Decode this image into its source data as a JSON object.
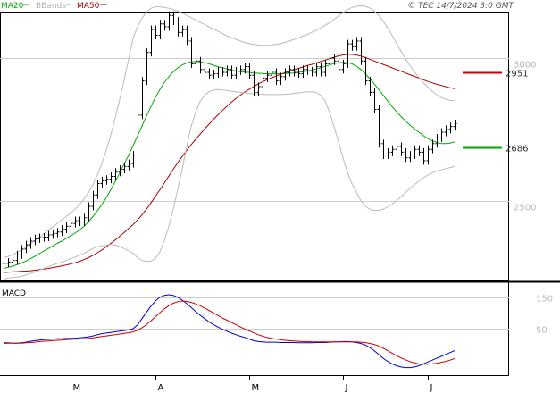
{
  "header": {
    "legend": [
      {
        "label": "MA20",
        "color": "#00aa00"
      },
      {
        "label": "BBands",
        "color": "#b0b0b0"
      },
      {
        "label": "MA50",
        "color": "#aa0000"
      }
    ],
    "source": "© TEC 14/7/2024 3:0 GMT"
  },
  "markers": {
    "resistance": {
      "value": 2951,
      "label": "2951",
      "color": "#cc0000"
    },
    "support": {
      "value": 2686,
      "label": "2686",
      "color": "#00aa00"
    }
  },
  "chart_data": [
    {
      "type": "line",
      "title": "",
      "series_kind": "ohlc-bars",
      "price_axis": {
        "ticks": [
          3000,
          2500
        ],
        "ylim": [
          2220,
          3160
        ]
      },
      "month_labels": [
        {
          "label": "M",
          "index": 15
        },
        {
          "label": "A",
          "index": 34
        },
        {
          "label": "M",
          "index": 55
        },
        {
          "label": "J",
          "index": 76
        },
        {
          "label": "J",
          "index": 95
        }
      ],
      "close": [
        2280,
        2284,
        2290,
        2310,
        2330,
        2345,
        2358,
        2366,
        2370,
        2372,
        2380,
        2385,
        2390,
        2400,
        2410,
        2420,
        2430,
        2425,
        2440,
        2480,
        2520,
        2560,
        2570,
        2575,
        2585,
        2600,
        2610,
        2620,
        2630,
        2660,
        2800,
        2920,
        3020,
        3100,
        3080,
        3120,
        3110,
        3150,
        3130,
        3090,
        3100,
        3060,
        2980,
        2990,
        2960,
        2950,
        2940,
        2945,
        2955,
        2950,
        2960,
        2940,
        2955,
        2960,
        2970,
        2940,
        2880,
        2900,
        2930,
        2940,
        2950,
        2920,
        2935,
        2950,
        2960,
        2950,
        2945,
        2960,
        2955,
        2950,
        2970,
        2950,
        2980,
        3000,
        2990,
        2960,
        2980,
        3050,
        3040,
        3060,
        2990,
        2920,
        2880,
        2820,
        2700,
        2660,
        2670,
        2680,
        2690,
        2670,
        2650,
        2660,
        2680,
        2670,
        2640,
        2680,
        2700,
        2720,
        2740,
        2750,
        2760,
        2770
      ],
      "series": [
        {
          "name": "MA20",
          "values": [
            2262,
            2266,
            2270,
            2275,
            2281,
            2288,
            2296,
            2305,
            2314,
            2323,
            2332,
            2341,
            2350,
            2358,
            2367,
            2376,
            2386,
            2397,
            2410,
            2426,
            2444,
            2464,
            2486,
            2510,
            2538,
            2567,
            2597,
            2628,
            2660,
            2693,
            2727,
            2762,
            2797,
            2830,
            2862,
            2890,
            2914,
            2935,
            2952,
            2966,
            2976,
            2983,
            2987,
            2988,
            2987,
            2984,
            2980,
            2975,
            2970,
            2966,
            2962,
            2958,
            2955,
            2953,
            2951,
            2950,
            2948,
            2947,
            2946,
            2945,
            2945,
            2945,
            2945,
            2946,
            2947,
            2948,
            2950,
            2952,
            2955,
            2958,
            2962,
            2966,
            2971,
            2976,
            2981,
            2984,
            2985,
            2984,
            2980,
            2972,
            2960,
            2945,
            2928,
            2910,
            2890,
            2870,
            2850,
            2830,
            2812,
            2795,
            2780,
            2765,
            2752,
            2740,
            2728,
            2718,
            2710,
            2704,
            2700,
            2700,
            2702,
            2706
          ]
        },
        {
          "name": "MA50",
          "values": [
            2248,
            2249,
            2250,
            2251,
            2252,
            2253,
            2254,
            2256,
            2258,
            2260,
            2262,
            2265,
            2268,
            2271,
            2274,
            2278,
            2282,
            2287,
            2293,
            2300,
            2308,
            2317,
            2327,
            2338,
            2350,
            2362,
            2375,
            2388,
            2402,
            2416,
            2432,
            2450,
            2470,
            2492,
            2515,
            2538,
            2562,
            2586,
            2610,
            2633,
            2655,
            2676,
            2696,
            2715,
            2733,
            2751,
            2768,
            2785,
            2801,
            2816,
            2831,
            2845,
            2858,
            2870,
            2881,
            2891,
            2900,
            2909,
            2917,
            2924,
            2931,
            2937,
            2943,
            2949,
            2954,
            2959,
            2964,
            2969,
            2974,
            2978,
            2983,
            2988,
            2993,
            2998,
            3003,
            3008,
            3011,
            3013,
            3013,
            3011,
            3007,
            3002,
            2996,
            2990,
            2984,
            2978,
            2972,
            2966,
            2960,
            2954,
            2948,
            2942,
            2936,
            2930,
            2924,
            2918,
            2913,
            2908,
            2904,
            2900,
            2896,
            2893
          ]
        },
        {
          "name": "BBands upper",
          "values": [
            2300,
            2304,
            2310,
            2318,
            2327,
            2337,
            2348,
            2360,
            2372,
            2384,
            2396,
            2408,
            2420,
            2432,
            2444,
            2456,
            2470,
            2486,
            2505,
            2528,
            2556,
            2590,
            2630,
            2676,
            2730,
            2790,
            2855,
            2924,
            2996,
            3070,
            3110,
            3140,
            3162,
            3175,
            3180,
            3180,
            3178,
            3175,
            3170,
            3165,
            3158,
            3150,
            3142,
            3134,
            3126,
            3118,
            3110,
            3102,
            3094,
            3086,
            3078,
            3072,
            3066,
            3060,
            3055,
            3051,
            3048,
            3046,
            3045,
            3045,
            3046,
            3048,
            3051,
            3055,
            3060,
            3065,
            3071,
            3077,
            3083,
            3090,
            3098,
            3106,
            3115,
            3125,
            3136,
            3148,
            3160,
            3170,
            3178,
            3182,
            3184,
            3182,
            3176,
            3166,
            3150,
            3130,
            3106,
            3080,
            3052,
            3024,
            2998,
            2974,
            2952,
            2932,
            2914,
            2898,
            2884,
            2872,
            2862,
            2856,
            2852,
            2850
          ]
        },
        {
          "name": "BBands lower",
          "values": [
            2224,
            2228,
            2230,
            2232,
            2235,
            2239,
            2244,
            2250,
            2256,
            2262,
            2268,
            2274,
            2280,
            2284,
            2290,
            2296,
            2302,
            2308,
            2315,
            2324,
            2332,
            2338,
            2342,
            2344,
            2346,
            2344,
            2339,
            2332,
            2324,
            2316,
            2300,
            2290,
            2286,
            2288,
            2296,
            2320,
            2360,
            2410,
            2470,
            2540,
            2610,
            2690,
            2760,
            2810,
            2848,
            2870,
            2882,
            2888,
            2890,
            2888,
            2886,
            2884,
            2882,
            2880,
            2878,
            2876,
            2875,
            2874,
            2873,
            2872,
            2872,
            2872,
            2872,
            2873,
            2874,
            2876,
            2878,
            2880,
            2882,
            2882,
            2880,
            2870,
            2850,
            2810,
            2760,
            2706,
            2650,
            2600,
            2560,
            2530,
            2500,
            2480,
            2470,
            2466,
            2466,
            2470,
            2478,
            2488,
            2500,
            2514,
            2528,
            2542,
            2556,
            2568,
            2580,
            2590,
            2598,
            2604,
            2608,
            2612,
            2616,
            2620
          ]
        }
      ]
    },
    {
      "type": "line",
      "title": "MACD",
      "ylim": [
        -95,
        195
      ],
      "axis_ticks": [
        150,
        50
      ],
      "series": [
        {
          "name": "MACD",
          "values": [
            5,
            5,
            4,
            4,
            5,
            7,
            10,
            12,
            14,
            15,
            16,
            17,
            18,
            18,
            19,
            19,
            20,
            21,
            22,
            24,
            27,
            31,
            34,
            36,
            38,
            40,
            42,
            44,
            46,
            50,
            62,
            82,
            102,
            122,
            138,
            150,
            156,
            158,
            156,
            150,
            141,
            130,
            118,
            105,
            93,
            82,
            72,
            63,
            55,
            48,
            42,
            36,
            31,
            26,
            22,
            17,
            12,
            9,
            8,
            7,
            7,
            7,
            6,
            6,
            6,
            6,
            5,
            5,
            5,
            5,
            6,
            6,
            6,
            7,
            8,
            8,
            9,
            9,
            8,
            6,
            3,
            -2,
            -10,
            -20,
            -32,
            -44,
            -54,
            -62,
            -68,
            -72,
            -74,
            -74,
            -72,
            -68,
            -62,
            -56,
            -50,
            -44,
            -38,
            -32,
            -26,
            -20
          ]
        },
        {
          "name": "Signal",
          "values": [
            3,
            4,
            4,
            4,
            4,
            5,
            6,
            7,
            9,
            10,
            11,
            12,
            13,
            14,
            15,
            16,
            17,
            17,
            18,
            19,
            21,
            23,
            25,
            27,
            29,
            31,
            33,
            35,
            37,
            40,
            45,
            53,
            63,
            75,
            88,
            101,
            113,
            123,
            131,
            136,
            138,
            137,
            134,
            129,
            123,
            116,
            108,
            100,
            92,
            84,
            77,
            70,
            63,
            56,
            49,
            43,
            37,
            31,
            26,
            22,
            19,
            17,
            15,
            13,
            12,
            11,
            10,
            9,
            9,
            8,
            8,
            8,
            8,
            8,
            8,
            8,
            8,
            8,
            8,
            8,
            7,
            6,
            3,
            0,
            -5,
            -12,
            -20,
            -28,
            -36,
            -43,
            -49,
            -55,
            -59,
            -62,
            -63,
            -63,
            -62,
            -60,
            -57,
            -54,
            -50,
            -45
          ]
        }
      ]
    }
  ]
}
